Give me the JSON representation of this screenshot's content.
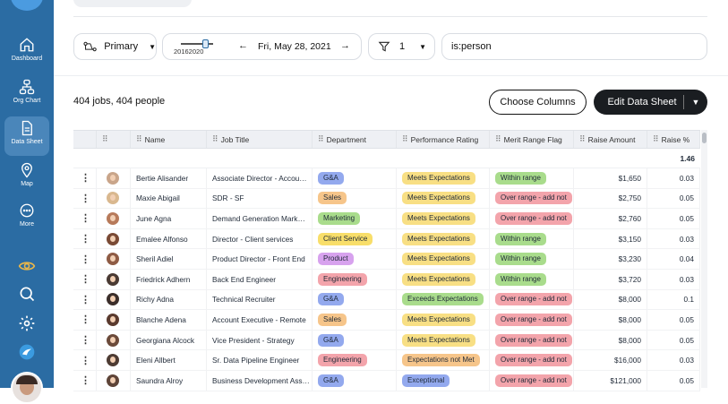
{
  "sidebar": {
    "items": [
      {
        "label": "Dashboard",
        "icon": "home-icon"
      },
      {
        "label": "Org Chart",
        "icon": "org-chart-icon"
      },
      {
        "label": "Data Sheet",
        "icon": "document-icon"
      },
      {
        "label": "Map",
        "icon": "map-pin-icon"
      },
      {
        "label": "More",
        "icon": "more-icon"
      }
    ],
    "bottom_icons": [
      "eye-icon",
      "search-icon",
      "gear-icon",
      "logo-icon"
    ]
  },
  "toolbar": {
    "view_label": "Primary",
    "slider_years": "20162020",
    "date_label": "Fri, May 28, 2021",
    "filter_count": "1",
    "query": "is:person"
  },
  "summary": {
    "count_text": "404 jobs, 404 people"
  },
  "actions": {
    "choose_columns": "Choose Columns",
    "edit_data_sheet": "Edit Data Sheet"
  },
  "table": {
    "headers": [
      "Name",
      "Job Title",
      "Department",
      "Performance Rating",
      "Merit Range Flag",
      "Raise Amount",
      "Raise %"
    ],
    "raise_pct_total": "1.46",
    "rows": [
      {
        "name": "Bertie Alisander",
        "title": "Associate Director - Accou…",
        "dept": "G&A",
        "perf": "Meets Expectations",
        "merit": "Within range",
        "raise": "$1,650",
        "pct": "0.03",
        "face": "#c9a58a"
      },
      {
        "name": "Maxie Abigail",
        "title": "SDR - SF",
        "dept": "Sales",
        "perf": "Meets Expectations",
        "merit": "Over range - add not",
        "raise": "$2,750",
        "pct": "0.05",
        "face": "#d9b88f"
      },
      {
        "name": "June Agna",
        "title": "Demand Generation Mark…",
        "dept": "Marketing",
        "perf": "Meets Expectations",
        "merit": "Over range - add not",
        "raise": "$2,760",
        "pct": "0.05",
        "face": "#b77a5a"
      },
      {
        "name": "Emalee Alfonso",
        "title": "Director - Client services",
        "dept": "Client Service",
        "perf": "Meets Expectations",
        "merit": "Within range",
        "raise": "$3,150",
        "pct": "0.03",
        "face": "#7a4a35"
      },
      {
        "name": "Sheril Adiel",
        "title": "Product Director - Front End",
        "dept": "Product",
        "perf": "Meets Expectations",
        "merit": "Within range",
        "raise": "$3,230",
        "pct": "0.04",
        "face": "#8e5b44"
      },
      {
        "name": "Friedrick Adhern",
        "title": "Back End Engineer",
        "dept": "Engineering",
        "perf": "Meets Expectations",
        "merit": "Within range",
        "raise": "$3,720",
        "pct": "0.03",
        "face": "#4a3a33"
      },
      {
        "name": "Richy Adna",
        "title": "Technical Recruiter",
        "dept": "G&A",
        "perf": "Exceeds Expectations",
        "merit": "Over range - add not",
        "raise": "$8,000",
        "pct": "0.1",
        "face": "#3b2e2a"
      },
      {
        "name": "Blanche Adena",
        "title": "Account Executive - Remote",
        "dept": "Sales",
        "perf": "Meets Expectations",
        "merit": "Over range - add not",
        "raise": "$8,000",
        "pct": "0.05",
        "face": "#5a3a2e"
      },
      {
        "name": "Georgiana Alcock",
        "title": "Vice President - Strategy",
        "dept": "G&A",
        "perf": "Meets Expectations",
        "merit": "Over range - add not",
        "raise": "$8,000",
        "pct": "0.05",
        "face": "#6b4a3a"
      },
      {
        "name": "Eleni Allbert",
        "title": "Sr. Data Pipeline Engineer",
        "dept": "Engineering",
        "perf": "Expectations not Met",
        "merit": "Over range - add not",
        "raise": "$16,000",
        "pct": "0.03",
        "face": "#4d3b33"
      },
      {
        "name": "Saundra Alroy",
        "title": "Business Development Ass…",
        "dept": "G&A",
        "perf": "Exceptional",
        "merit": "Over range - add not",
        "raise": "$121,000",
        "pct": "0.05",
        "face": "#5e4438"
      }
    ]
  },
  "colors": {
    "sidebar": "#2b6ca3",
    "dept": {
      "G&A": "#93a9ee",
      "Sales": "#f6c58a",
      "Marketing": "#a9dc8c",
      "Client Service": "#f8de6a",
      "Product": "#d7a2ee",
      "Engineering": "#f3a4ab"
    },
    "perf": {
      "Meets Expectations": "#f8df84",
      "Exceeds Expectations": "#a9dc8c",
      "Expectations not Met": "#f6c58a",
      "Exceptional": "#93a9ee"
    },
    "merit": {
      "Within range": "#a9dc8c",
      "Over range - add not": "#f3a4ab"
    }
  }
}
